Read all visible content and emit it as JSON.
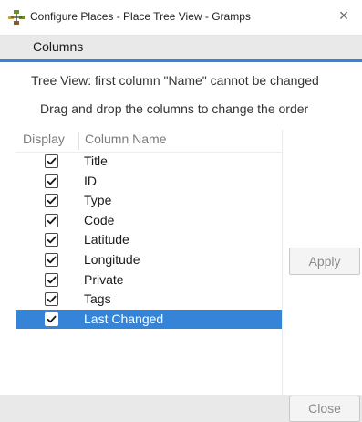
{
  "window": {
    "title": "Configure Places - Place Tree View - Gramps",
    "close_glyph": "×",
    "icon": "gramps-app-icon"
  },
  "tabs": [
    {
      "label": "Columns",
      "active": true
    }
  ],
  "notes": {
    "line1": "Tree View: first column \"Name\" cannot be changed",
    "line2": "Drag and drop the columns to change the order"
  },
  "table": {
    "headers": {
      "display": "Display",
      "column_name": "Column Name"
    },
    "rows": [
      {
        "label": "Title",
        "checked": true,
        "selected": false
      },
      {
        "label": "ID",
        "checked": true,
        "selected": false
      },
      {
        "label": "Type",
        "checked": true,
        "selected": false
      },
      {
        "label": "Code",
        "checked": true,
        "selected": false
      },
      {
        "label": "Latitude",
        "checked": true,
        "selected": false
      },
      {
        "label": "Longitude",
        "checked": true,
        "selected": false
      },
      {
        "label": "Private",
        "checked": true,
        "selected": false
      },
      {
        "label": "Tags",
        "checked": true,
        "selected": false
      },
      {
        "label": "Last Changed",
        "checked": true,
        "selected": true
      }
    ]
  },
  "buttons": {
    "apply": "Apply",
    "close": "Close"
  },
  "colors": {
    "accent": "#3584d8",
    "tab_bg": "#e9e9e9"
  }
}
